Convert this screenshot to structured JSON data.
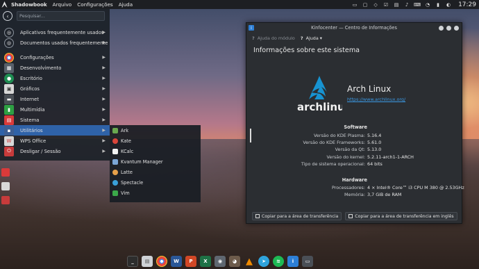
{
  "topbar": {
    "app_name": "Shadowbook",
    "menu": [
      "Arquivo",
      "Configurações",
      "Ajuda"
    ],
    "clock": "17:29"
  },
  "app_menu": {
    "search_placeholder": "Pesquisar...",
    "items": [
      {
        "label": "Aplicativos frequentemente usados",
        "icon": "star-icon",
        "color": "#3b4350"
      },
      {
        "label": "Documentos usados frequentemente",
        "icon": "document-icon",
        "color": "#3b4350"
      },
      {
        "label": "Configurações",
        "icon": "chrome-icon",
        "color": "#e8453c"
      },
      {
        "label": "Desenvolvimento",
        "icon": "development-icon",
        "color": "#58606a"
      },
      {
        "label": "Escritório",
        "icon": "office-icon",
        "color": "#1e8d52"
      },
      {
        "label": "Gráficos",
        "icon": "graphics-icon",
        "color": "#d8d8d8"
      },
      {
        "label": "Internet",
        "icon": "internet-icon",
        "color": "#4a4f56"
      },
      {
        "label": "Multimídia",
        "icon": "multimedia-icon",
        "color": "#2ea043"
      },
      {
        "label": "Sistema",
        "icon": "system-icon",
        "color": "#d93a3a"
      },
      {
        "label": "Utilitários",
        "icon": "utilities-icon",
        "color": "#3c5e94"
      },
      {
        "label": "WPS Office",
        "icon": "wps-icon",
        "color": "#d8d8d8"
      },
      {
        "label": "Desligar / Sessão",
        "icon": "power-icon",
        "color": "#c73b3b"
      }
    ]
  },
  "submenu": {
    "items": [
      {
        "label": "Ark",
        "color": "#6aa84f"
      },
      {
        "label": "Kate",
        "color": "#d9453a"
      },
      {
        "label": "KCalc",
        "color": "#f2f2f2"
      },
      {
        "label": "Kvantum Manager",
        "color": "#7ba6d6"
      },
      {
        "label": "Latte",
        "color": "#e6a04a"
      },
      {
        "label": "Spectacle",
        "color": "#3aa0d8"
      },
      {
        "label": "Vim",
        "color": "#3ba84a"
      }
    ]
  },
  "kinfocenter": {
    "title": "Kinfocenter — Centro de Informações",
    "toolbar": {
      "module_help": "Ajuda do módulo",
      "help": "Ajuda"
    },
    "heading": "Informações sobre este sistema",
    "distro_name": "Arch Linux",
    "distro_url": "https://www.archlinux.org/",
    "logo_text": "archlinux",
    "software_title": "Software",
    "software": [
      {
        "key": "Versão do KDE Plasma:",
        "value": "5.16.4"
      },
      {
        "key": "Versão do KDE Frameworks:",
        "value": "5.61.0"
      },
      {
        "key": "Versão da Qt:",
        "value": "5.13.0"
      },
      {
        "key": "Versão do kernel:",
        "value": "5.2.11-arch1-1-ARCH"
      },
      {
        "key": "Tipo de sistema operacional:",
        "value": "64 bits"
      }
    ],
    "hardware_title": "Hardware",
    "hardware": [
      {
        "key": "Processadores:",
        "value": "4 × Intel® Core™ i3 CPU M 380 @ 2.53GHz"
      },
      {
        "key": "Memória:",
        "value": "3,7 GiB de RAM"
      }
    ],
    "copy_button": "Copiar para a área de transferência",
    "copy_en_button": "Copiar para a área de transferência em inglês"
  },
  "dock": [
    {
      "icon": "terminal-icon",
      "color": "#2d2d2d"
    },
    {
      "icon": "file-manager-icon",
      "color": "#cfd2d6"
    },
    {
      "icon": "chrome-icon",
      "color": "#e8453c"
    },
    {
      "icon": "word-icon",
      "color": "#2b5797"
    },
    {
      "icon": "powerpoint-icon",
      "color": "#d24726"
    },
    {
      "icon": "excel-icon",
      "color": "#1e7145"
    },
    {
      "icon": "screenshot-icon",
      "color": "#5f6770"
    },
    {
      "icon": "gimp-icon",
      "color": "#6d5b4b"
    },
    {
      "icon": "vlc-icon",
      "color": "#f08a00"
    },
    {
      "icon": "telegram-icon",
      "color": "#2fa3dc"
    },
    {
      "icon": "spotify-icon",
      "color": "#1db954"
    },
    {
      "icon": "info-icon",
      "color": "#2d7fd6"
    },
    {
      "icon": "window-icon",
      "color": "#4a4f56"
    }
  ]
}
